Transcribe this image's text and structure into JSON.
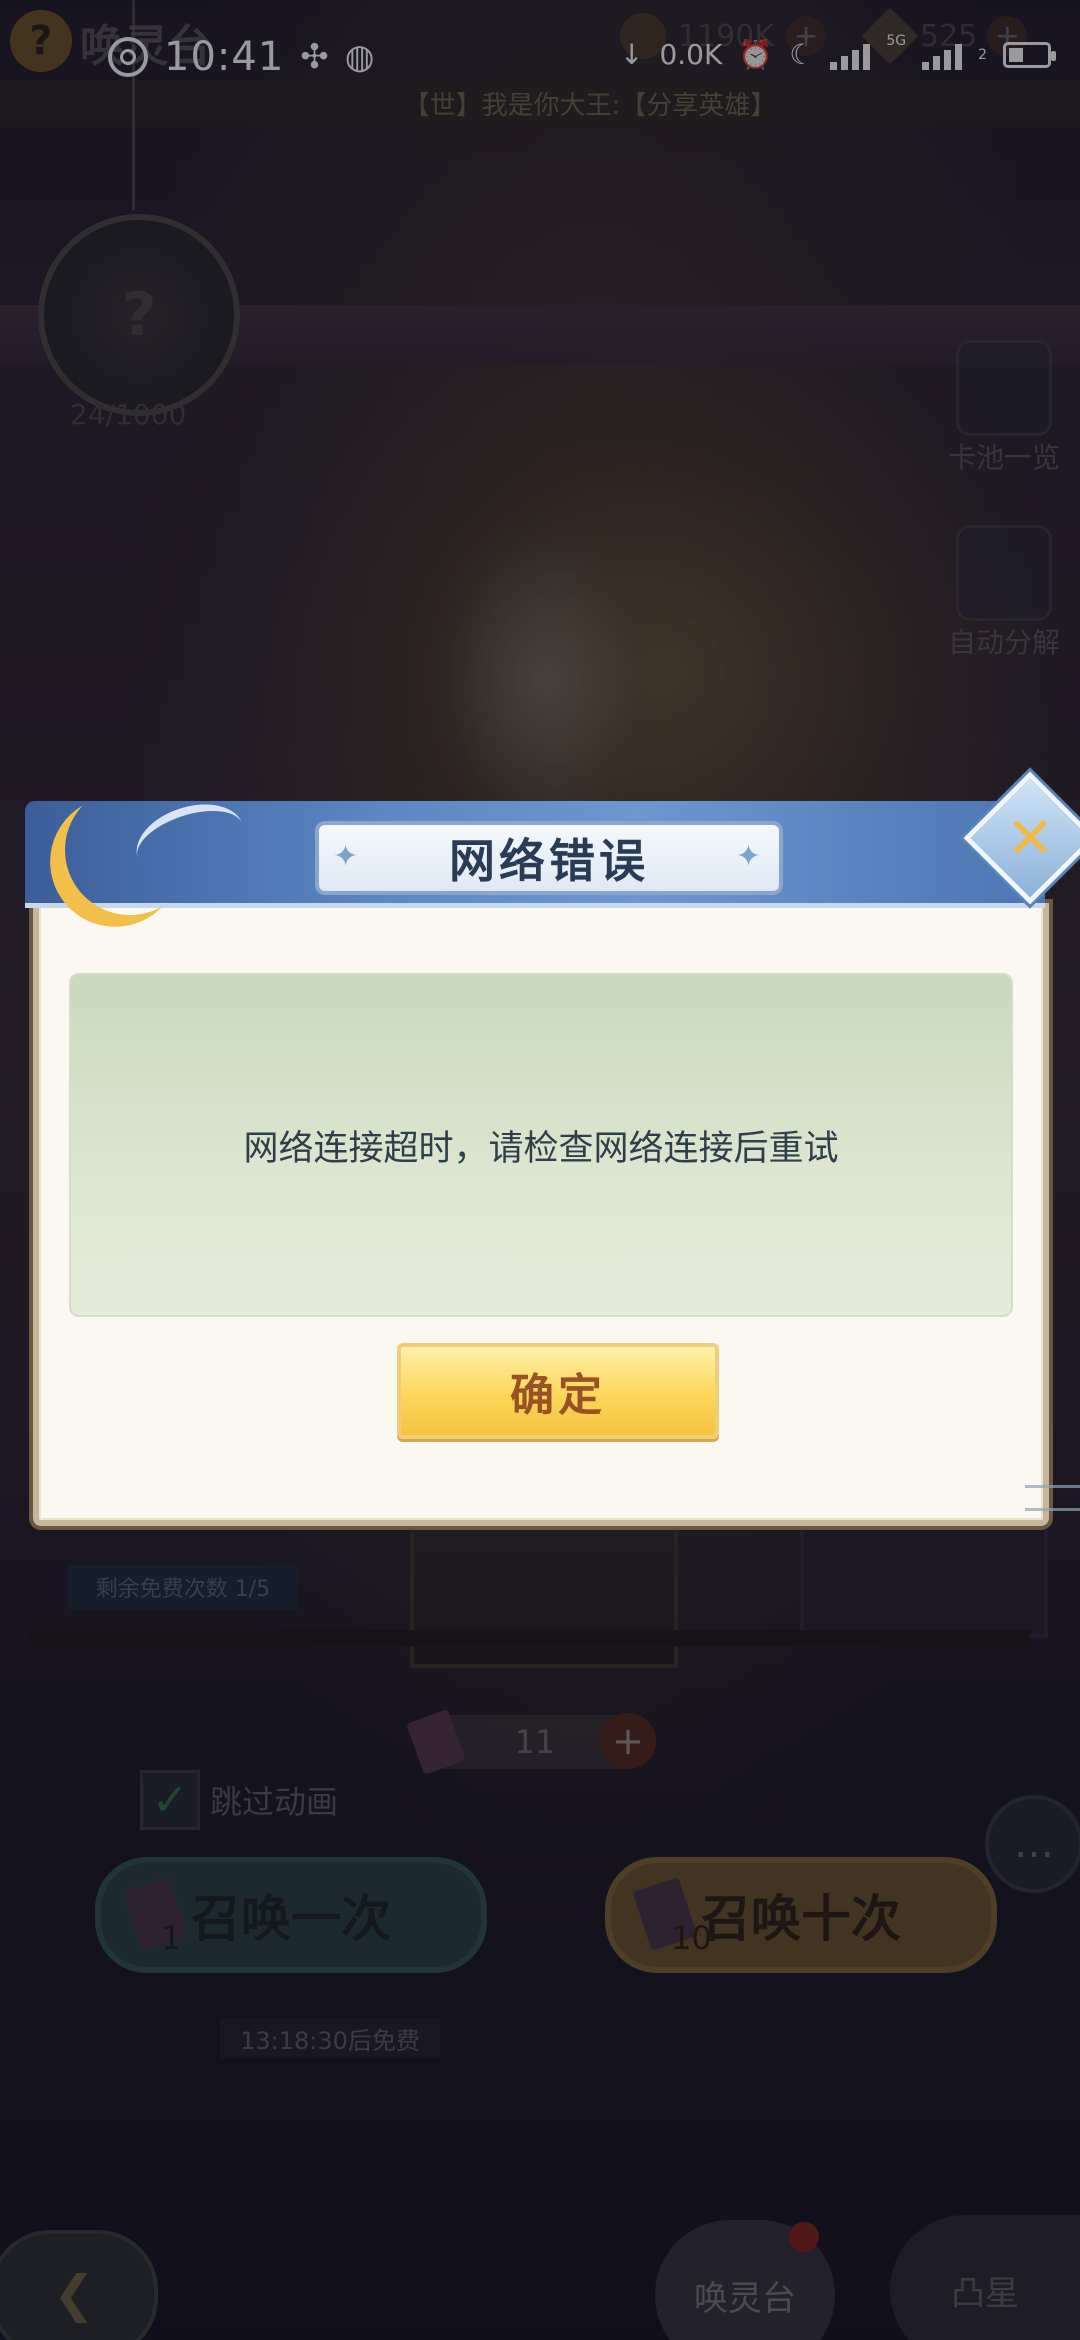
{
  "status_bar": {
    "time": "10:41",
    "net_speed": "0.0K",
    "net_type": "5G",
    "sim_slot": "2"
  },
  "game": {
    "help_glyph": "?",
    "screen_title": "唤灵台",
    "coins": "1190K",
    "gems": "525",
    "ticker": "【世】我是你大王:【分享英雄】",
    "pendant_glyph": "?",
    "pendant_count": "24/1000",
    "side_buttons": {
      "pool": "卡池一览",
      "auto_decompose": "自动分解"
    },
    "free_remaining": "剩余免费次数 1/5",
    "ticket_count": "11",
    "skip_animation": "跳过动画",
    "summon_once": {
      "label": "召唤一次",
      "cost": "1"
    },
    "summon_ten": {
      "label": "召唤十次",
      "cost": "10"
    },
    "free_timer": "13:18:30后免费",
    "nav": {
      "main": "唤灵台",
      "right": "凸星"
    }
  },
  "dialog": {
    "title": "网络错误",
    "message": "网络连接超时，请检查网络连接后重试",
    "confirm_label": "确定"
  },
  "colors": {
    "dialog_header": "#5b87c4",
    "dialog_body": "#fbf8f1",
    "message_box": "#dbe5cf",
    "confirm_button": "#fbd65a",
    "confirm_text": "#9a5224"
  }
}
